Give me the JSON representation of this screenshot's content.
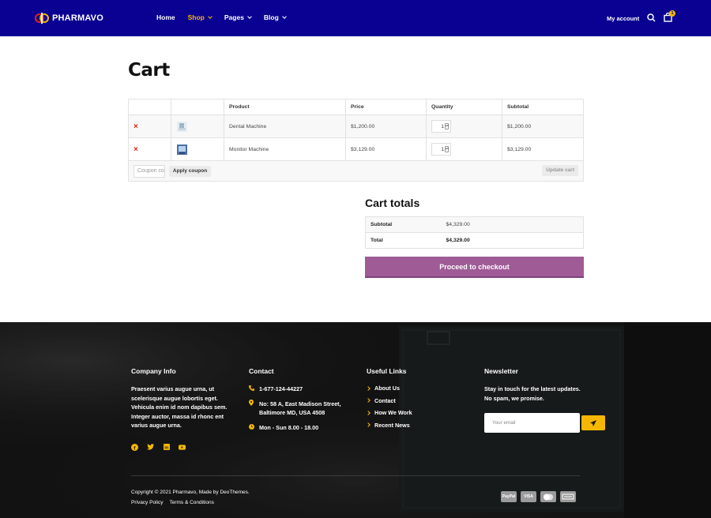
{
  "header": {
    "logo_text": "PHARMAVO",
    "nav": [
      {
        "label": "Home",
        "has_dropdown": false,
        "active": false
      },
      {
        "label": "Shop",
        "has_dropdown": true,
        "active": true
      },
      {
        "label": "Pages",
        "has_dropdown": true,
        "active": false
      },
      {
        "label": "Blog",
        "has_dropdown": true,
        "active": false
      }
    ],
    "account_label": "My account",
    "cart_count": "1",
    "icons": [
      "search-icon",
      "shopping-bag-icon"
    ]
  },
  "cart": {
    "title": "Cart",
    "columns": [
      "",
      "",
      "Product",
      "Price",
      "Quantity",
      "Subtotal"
    ],
    "items": [
      {
        "name": "Dental Machine",
        "price": "$1,200.00",
        "qty": "1",
        "subtotal": "$1,200.00"
      },
      {
        "name": "Monitor Machine",
        "price": "$3,129.00",
        "qty": "1",
        "subtotal": "$3,129.00"
      }
    ],
    "coupon_placeholder": "Coupon code",
    "apply_label": "Apply coupon",
    "update_label": "Update cart"
  },
  "totals": {
    "title": "Cart totals",
    "subtotal_label": "Subtotal",
    "subtotal_value": "$4,329.00",
    "total_label": "Total",
    "total_value": "$4,329.00",
    "checkout_label": "Proceed to checkout"
  },
  "footer": {
    "company": {
      "title": "Company Info",
      "text": "Praesent varius augue urna, ut scelerisque augue lobortis eget. Vehicula enim id nom dapibus sem. Integer auctor, massa id rhonc ent varius augue urna."
    },
    "contact": {
      "title": "Contact",
      "phone": "1-677-124-44227",
      "address": "No: 58 A, East Madison Street, Baltimore MD, USA 4508",
      "hours": "Mon - Sun 8.00 - 18.00"
    },
    "links": {
      "title": "Useful Links",
      "items": [
        "About Us",
        "Contact",
        "How We Work",
        "Recent News"
      ]
    },
    "newsletter": {
      "title": "Newsletter",
      "text": "Stay in touch for the latest updates. No spam, we promise.",
      "placeholder": "Your email"
    },
    "copyright": "Copyright © 2021 Pharmavo, Made by DeoThemes.",
    "legal": [
      "Privacy Policy",
      "Terms & Conditions"
    ],
    "payment": [
      "PayPal",
      "VISA",
      "MC",
      "AMEX"
    ]
  },
  "colors": {
    "header_bg": "#0a0092",
    "accent": "#f5b700",
    "checkout_bg": "#9e5b96",
    "remove": "#e2231a",
    "footer_bg": "#161616"
  }
}
